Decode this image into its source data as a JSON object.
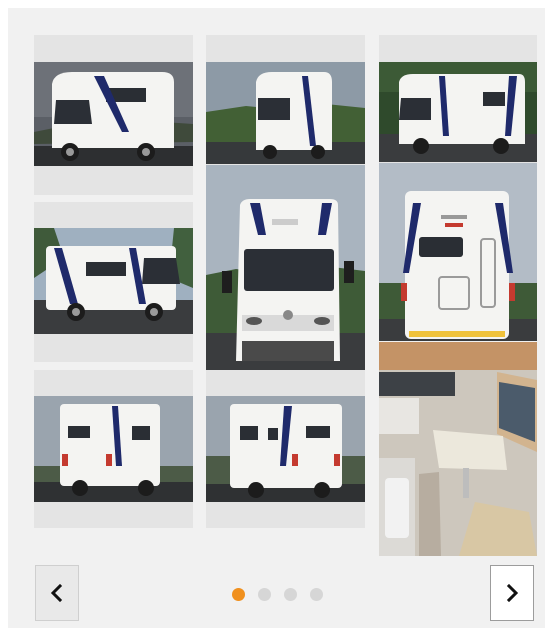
{
  "gallery": {
    "photos": [
      {
        "name": "camper-front-left-photo"
      },
      {
        "name": "camper-front-right-photo"
      },
      {
        "name": "camper-right-side-photo"
      },
      {
        "name": "camper-left-side-photo"
      },
      {
        "name": "camper-front-view-photo"
      },
      {
        "name": "camper-rear-view-photo"
      },
      {
        "name": "camper-rear-left-photo"
      },
      {
        "name": "camper-rear-right-photo"
      },
      {
        "name": "camper-interior-photo"
      }
    ]
  },
  "pagination": {
    "page_count": 4,
    "current_page": 1
  },
  "icons": {
    "prev": "chevron-left-icon",
    "next": "chevron-right-icon"
  },
  "colors": {
    "panel_background": "#f1f1f1",
    "cell_background": "#e4e4e4",
    "active_dot": "#f0901e",
    "inactive_dot": "#d6d6d6",
    "camper_body": "#f4f4f2",
    "camper_stripe": "#1f2a6b"
  }
}
